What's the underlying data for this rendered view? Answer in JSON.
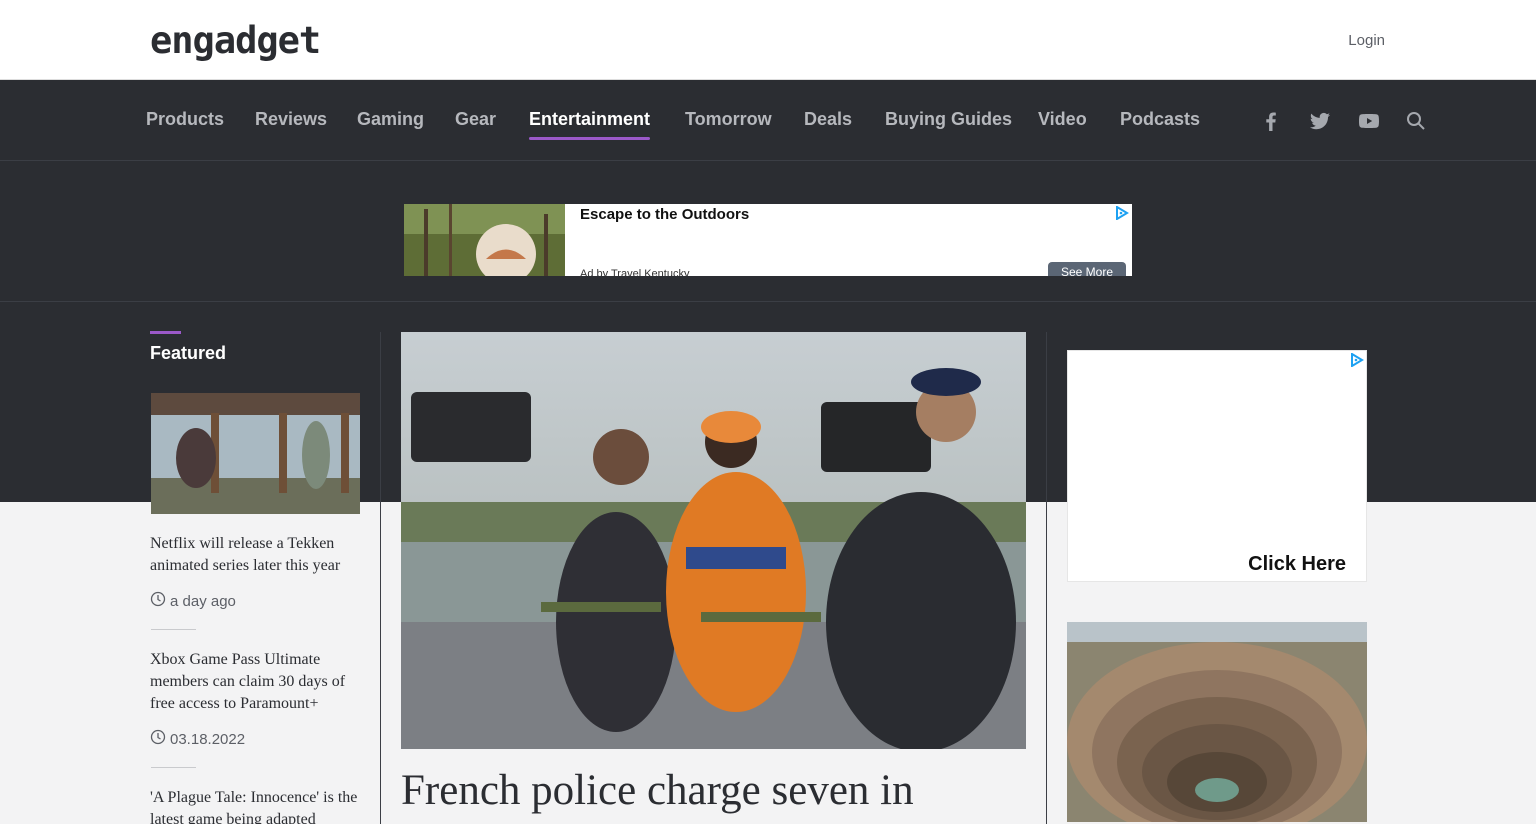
{
  "header": {
    "logo": "engadget",
    "login": "Login"
  },
  "nav": {
    "items": [
      {
        "label": "Products"
      },
      {
        "label": "Reviews"
      },
      {
        "label": "Gaming"
      },
      {
        "label": "Gear"
      },
      {
        "label": "Entertainment",
        "active": true
      },
      {
        "label": "Tomorrow"
      },
      {
        "label": "Deals"
      },
      {
        "label": "Buying Guides"
      },
      {
        "label": "Video"
      },
      {
        "label": "Podcasts"
      }
    ],
    "social_icons": [
      "facebook-icon",
      "twitter-icon",
      "youtube-icon",
      "search-icon"
    ]
  },
  "ad_top": {
    "title": "Escape to the Outdoors",
    "advertiser": "Ad by Travel Kentucky",
    "button": "See More"
  },
  "featured": {
    "label": "Featured",
    "items": [
      {
        "title": "Netflix will release a Tekken animated series later this year",
        "time": "a day ago"
      },
      {
        "title": "Xbox Game Pass Ultimate members can claim 30 days of free access to Paramount+",
        "time": "03.18.2022"
      },
      {
        "title": "'A Plague Tale: Innocence' is the latest game being adapted"
      }
    ]
  },
  "main": {
    "headline": "French police charge seven in"
  },
  "ad_right": {
    "cta": "Click Here"
  },
  "colors": {
    "nav_bg": "#2b2d32",
    "accent": "#9b59c9",
    "page_bg": "#f3f3f4"
  }
}
